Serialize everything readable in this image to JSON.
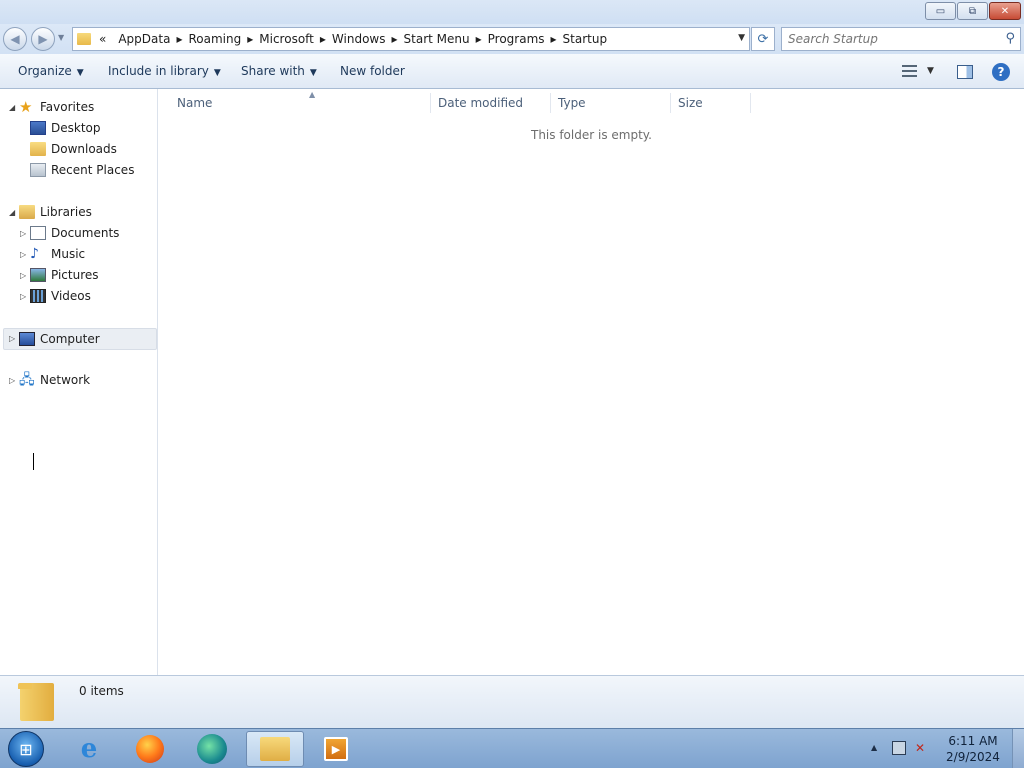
{
  "window": {
    "buttons": {
      "minimize": "▭",
      "maximize": "⧉",
      "close": "✕"
    }
  },
  "address": {
    "overflow": "«",
    "crumbs": [
      "AppData",
      "Roaming",
      "Microsoft",
      "Windows",
      "Start Menu",
      "Programs",
      "Startup"
    ]
  },
  "search": {
    "placeholder": "Search Startup"
  },
  "toolbar": {
    "organize": "Organize",
    "include_in_library": "Include in library",
    "share_with": "Share with",
    "new_folder": "New folder"
  },
  "nav": {
    "favorites": {
      "label": "Favorites",
      "items": [
        "Desktop",
        "Downloads",
        "Recent Places"
      ]
    },
    "libraries": {
      "label": "Libraries",
      "items": [
        "Documents",
        "Music",
        "Pictures",
        "Videos"
      ]
    },
    "computer": "Computer",
    "network": "Network"
  },
  "columns": {
    "name": "Name",
    "date_modified": "Date modified",
    "type": "Type",
    "size": "Size"
  },
  "content": {
    "empty_message": "This folder is empty."
  },
  "details": {
    "item_count": "0 items"
  },
  "taskbar": {
    "time": "6:11 AM",
    "date": "2/9/2024"
  },
  "icons": {
    "back": "back-arrow-icon",
    "forward": "forward-arrow-icon",
    "refresh": "refresh-icon",
    "search": "search-icon",
    "help": "help-icon"
  }
}
